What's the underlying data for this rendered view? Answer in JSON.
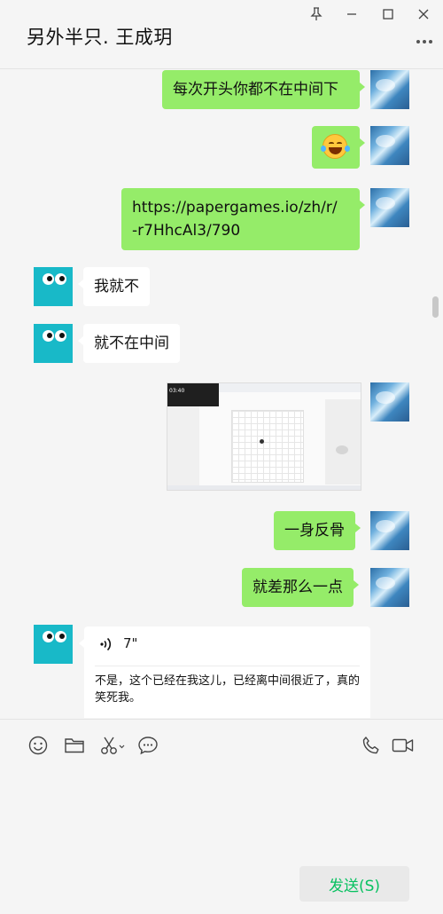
{
  "header": {
    "title": "另外半只. 王成玥"
  },
  "messages": {
    "m1": "每次开头你都不在中间下",
    "m2_emoji": "laughing-with-tears-emoji",
    "m3_line1": "https://papergames.io/zh/r/",
    "m3_line2": "-r7HhcAl3/790",
    "m4": "我就不",
    "m5": "就不在中间",
    "m6_screenshot": {
      "time": "03:40"
    },
    "m7": "一身反骨",
    "m8": "就差那么一点",
    "m9": {
      "duration": "7\"",
      "transcript": "不是，这个已经在我这儿，已经离中间很近了，真的笑死我。"
    }
  },
  "composer": {
    "send_label": "发送(S)"
  },
  "colors": {
    "my_bubble": "#95ec69",
    "their_bubble": "#ffffff",
    "send_text": "#07c160",
    "ghost_avatar": "#18b9c8"
  },
  "icons": [
    "pin-icon",
    "minimize-icon",
    "maximize-icon",
    "close-icon",
    "more-icon",
    "emoji-icon",
    "folder-icon",
    "scissors-icon",
    "chat-bubble-icon",
    "phone-icon",
    "video-icon",
    "voice-icon"
  ]
}
